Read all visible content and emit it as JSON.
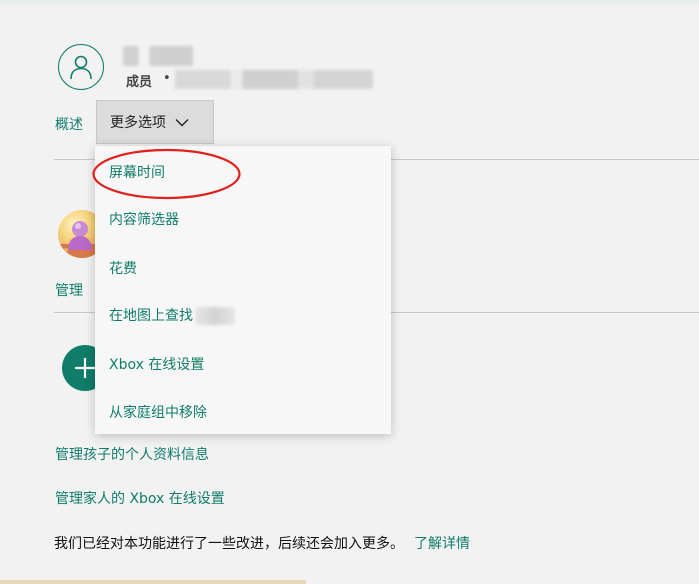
{
  "header": {
    "member_role": "成员",
    "separator": "•"
  },
  "tabs": {
    "overview": "概述",
    "more_options": "更多选项"
  },
  "dropdown": {
    "items": [
      "屏幕时间",
      "内容筛选器",
      "花费",
      "在地图上查找",
      "Xbox 在线设置",
      "从家庭组中移除"
    ]
  },
  "child_card": {
    "manage_partial": "管理"
  },
  "links": {
    "manage_child_profile": "管理孩子的个人资料信息",
    "manage_family_xbox": "管理家人的 Xbox 在线设置"
  },
  "notice": {
    "text": "我们已经对本功能进行了一些改进，后续还会加入更多。",
    "learn_more": "了解详情"
  },
  "colors": {
    "accent": "#107c6a",
    "highlight": "#e0201c",
    "background": "#f2f2f2"
  },
  "icons": {
    "avatar": "person-icon",
    "dropdown": "chevron-down-icon",
    "add": "plus-icon"
  }
}
